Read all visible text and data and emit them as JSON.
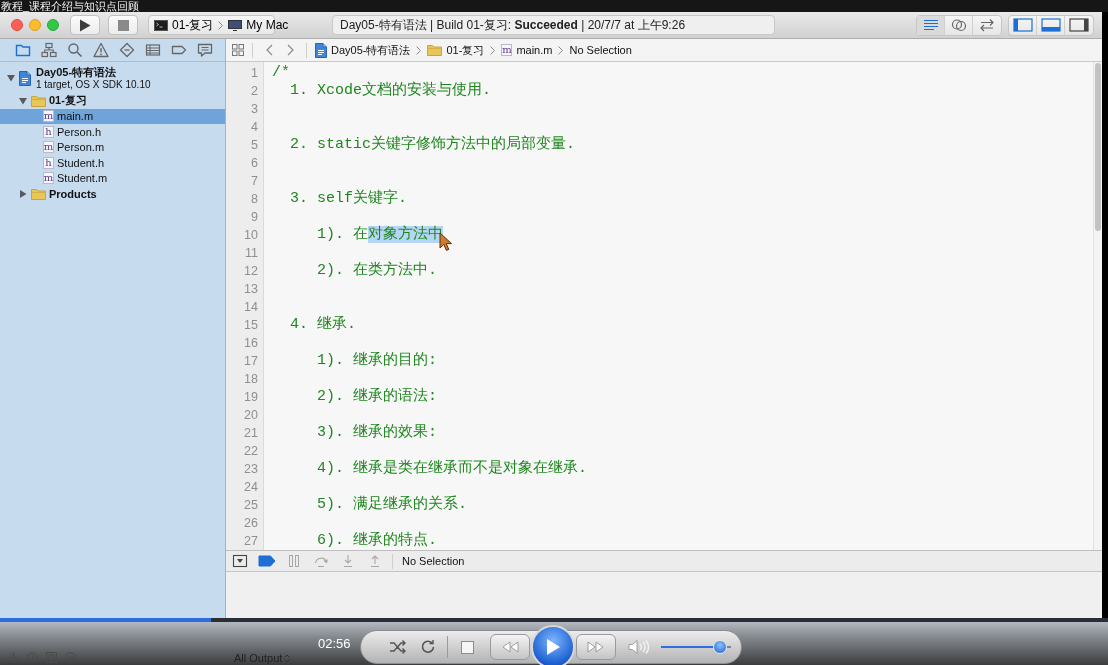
{
  "video_title": "教程_课程介绍与知识点回顾",
  "toolbar": {
    "scheme": "01-复习",
    "destination": "My Mac",
    "activity": "Day05-特有语法 | Build 01-复习: **Succeeded** | 20/7/7 at 上午9:26",
    "editor_modes": [
      {
        "kind": "standard",
        "selected": true
      },
      {
        "kind": "assistant",
        "selected": false
      },
      {
        "kind": "version",
        "selected": false
      }
    ],
    "panels": [
      {
        "kind": "navigator",
        "selected": true
      },
      {
        "kind": "debug",
        "selected": true
      },
      {
        "kind": "utilities",
        "selected": false
      }
    ]
  },
  "navigator": {
    "tabs": [
      {
        "kind": "project",
        "selected": true
      },
      {
        "kind": "symbol",
        "selected": false
      },
      {
        "kind": "find",
        "selected": false
      },
      {
        "kind": "issue",
        "selected": false
      },
      {
        "kind": "test",
        "selected": false
      },
      {
        "kind": "debug",
        "selected": false
      },
      {
        "kind": "breakpoint",
        "selected": false
      },
      {
        "kind": "report",
        "selected": false
      }
    ],
    "tree": [
      {
        "kind": "project",
        "name": "Day05-特有语法",
        "subtitle": "1 target, OS X SDK 10.10",
        "expanded": true,
        "selected": false,
        "children": [
          {
            "kind": "folder",
            "name": "01-复习",
            "expanded": true,
            "selected": false,
            "children": [
              {
                "kind": "file",
                "badge": "m",
                "name": "main.m",
                "selected": true
              },
              {
                "kind": "file",
                "badge": "h",
                "name": "Person.h",
                "selected": false
              },
              {
                "kind": "file",
                "badge": "m",
                "name": "Person.m",
                "selected": false
              },
              {
                "kind": "file",
                "badge": "h",
                "name": "Student.h",
                "selected": false
              },
              {
                "kind": "file",
                "badge": "m",
                "name": "Student.m",
                "selected": false
              }
            ]
          },
          {
            "kind": "folder",
            "name": "Products",
            "expanded": false,
            "selected": false
          }
        ]
      }
    ]
  },
  "jump_bar": [
    {
      "kind": "project",
      "label": "Day05-特有语法"
    },
    {
      "kind": "folder",
      "label": "01-复习"
    },
    {
      "kind": "file",
      "badge": "m",
      "label": "main.m"
    },
    {
      "kind": "plain",
      "label": "No Selection"
    }
  ],
  "editor": {
    "lines": [
      {
        "number": "1",
        "text": "/*"
      },
      {
        "number": "2",
        "text": "  1. Xcode文档的安装与使用."
      },
      {
        "number": "3"
      },
      {
        "number": "4"
      },
      {
        "number": "5",
        "text": "  2. static关键字修饰方法中的局部变量."
      },
      {
        "number": "6"
      },
      {
        "number": "7"
      },
      {
        "number": "8",
        "text": "  3. self关键字."
      },
      {
        "number": "9"
      },
      {
        "number": "10",
        "text": "     1). 在",
        "selection": "对象方法中"
      },
      {
        "number": "11"
      },
      {
        "number": "12",
        "text": "     2). 在类方法中."
      },
      {
        "number": "13"
      },
      {
        "number": "14"
      },
      {
        "number": "15",
        "text": "  4. 继承."
      },
      {
        "number": "16"
      },
      {
        "number": "17",
        "text": "     1). 继承的目的:"
      },
      {
        "number": "18"
      },
      {
        "number": "19",
        "text": "     2). 继承的语法:"
      },
      {
        "number": "20"
      },
      {
        "number": "21",
        "text": "     3). 继承的效果:"
      },
      {
        "number": "22"
      },
      {
        "number": "23",
        "text": "     4). 继承是类在继承而不是对象在继承."
      },
      {
        "number": "24"
      },
      {
        "number": "25",
        "text": "     5). 满足继承的关系."
      },
      {
        "number": "26"
      },
      {
        "number": "27",
        "text": "     6). 继承的特点."
      }
    ]
  },
  "debug_bar": {
    "breakpoints_active": true,
    "controls": [
      {
        "kind": "pause",
        "disabled": true
      },
      {
        "kind": "step-over",
        "disabled": true
      },
      {
        "kind": "step-into",
        "disabled": true
      },
      {
        "kind": "step-out",
        "disabled": true
      }
    ],
    "status": "No Selection"
  },
  "debug_area": {
    "filter": "All Output"
  },
  "player": {
    "progress": {
      "level": 0.19
    },
    "time": "02:56",
    "volume": {
      "level": 0.92
    }
  }
}
